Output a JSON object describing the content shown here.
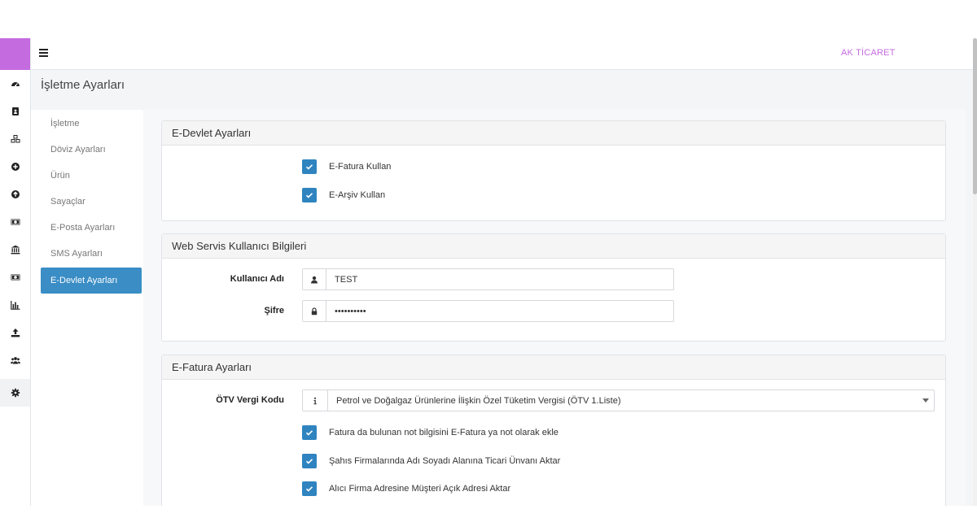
{
  "topbar": {
    "company": "AK TİCARET"
  },
  "page": {
    "title": "İşletme Ayarları"
  },
  "sidebar": {
    "icons": [
      "dashboard-icon",
      "address-book-icon",
      "cubes-icon",
      "plus-circle-icon",
      "arrow-up-circle-icon",
      "money-bill-icon",
      "bank-icon",
      "money-bill-icon",
      "bar-chart-icon",
      "upload-icon",
      "users-icon",
      "cog-icon"
    ],
    "active_index": 11
  },
  "settings_nav": {
    "items": [
      "İşletme",
      "Döviz Ayarları",
      "Ürün",
      "Sayaçlar",
      "E-Posta Ayarları",
      "SMS Ayarları",
      "E-Devlet Ayarları"
    ],
    "active": "E-Devlet Ayarları"
  },
  "edevlet_panel": {
    "title": "E-Devlet Ayarları",
    "efatura_label": "E-Fatura Kullan",
    "efatura_checked": true,
    "earsiv_label": "E-Arşiv Kullan",
    "earsiv_checked": true
  },
  "webservice_panel": {
    "title": "Web Servis Kullanıcı Bilgileri",
    "username_label": "Kullanıcı Adı",
    "username_value": "TEST",
    "password_label": "Şifre",
    "password_value": "••••••••••"
  },
  "efatura_panel": {
    "title": "E-Fatura Ayarları",
    "otv_label": "ÖTV Vergi Kodu",
    "otv_selected": "Petrol ve Doğalgaz Ürünlerine İlişkin Özel Tüketim Vergisi (ÖTV 1.Liste)",
    "options": [
      {
        "label": "Fatura da bulunan not bilgisini E-Fatura ya not olarak ekle",
        "checked": true
      },
      {
        "label": "Şahıs Firmalarında Adı Soyadı Alanına Ticari Ünvanı Aktar",
        "checked": true
      },
      {
        "label": "Alıcı Firma Adresine Müşteri Açık Adresi Aktar",
        "checked": true
      }
    ]
  },
  "colors": {
    "accent": "#c46be0",
    "primary": "#3a8dc5",
    "checkbox": "#2f84c0"
  }
}
